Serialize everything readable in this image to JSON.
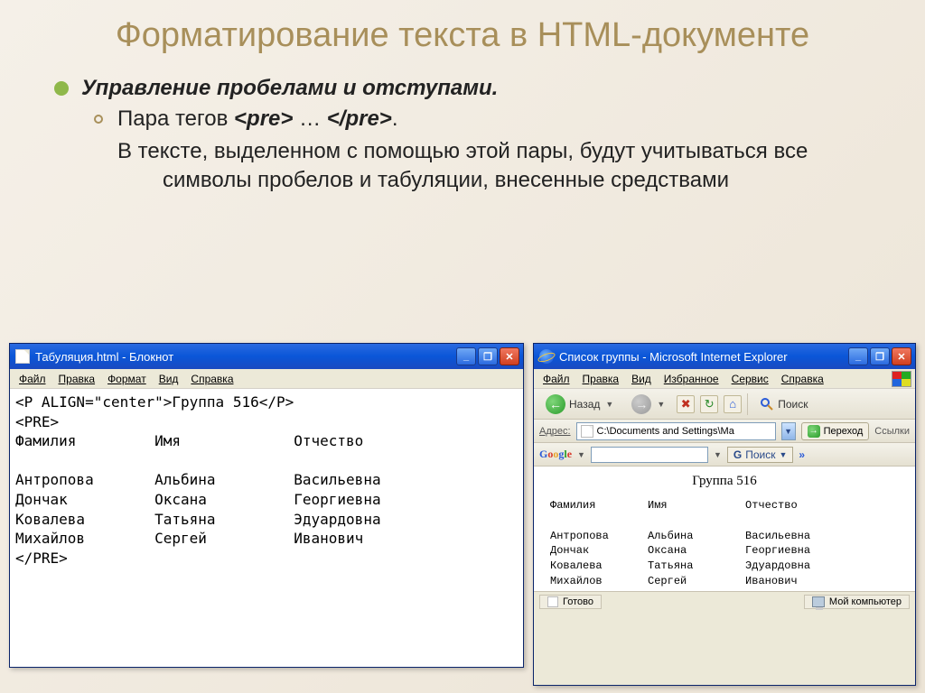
{
  "slide": {
    "title": "Форматирование текста в HTML-документе",
    "bullet1": "Управление пробелами и отступами.",
    "sub_prefix": "Пара тегов ",
    "sub_tag1": "<pre>",
    "sub_mid": " … ",
    "sub_tag2": "</pre>",
    "sub_end": ".",
    "para": "В тексте, выделенном с помощью этой пары, будут    учитываться все символы пробелов и табуляции,    внесенные средствами"
  },
  "notepad": {
    "title": "Табуляция.html - Блокнот",
    "menu": [
      "Файл",
      "Правка",
      "Формат",
      "Вид",
      "Справка"
    ],
    "code": "<P ALIGN=\"center\">Группа 516</P>\n<PRE>\nФамилия         Имя             Отчество\n\nАнтропова       Альбина         Васильевна\nДончак          Оксана          Георгиевна\nКовалева        Татьяна         Эдуардовна\nМихайлов        Сергей          Иванович\n</PRE>",
    "win_btns": {
      "min": "_",
      "max": "❐",
      "close": "✕"
    }
  },
  "ie": {
    "title": "Список группы - Microsoft Internet Explorer",
    "menu": [
      "Файл",
      "Правка",
      "Вид",
      "Избранное",
      "Сервис",
      "Справка"
    ],
    "toolbar": {
      "back": "Назад",
      "search": "Поиск",
      "stop_icon": "✖",
      "refresh_icon": "↻",
      "home_icon": "⌂"
    },
    "address": {
      "label": "Адрес:",
      "value": "C:\\Documents and Settings\\Ма",
      "go": "Переход",
      "links": "Ссылки"
    },
    "google": {
      "label_parts": [
        "G",
        "o",
        "o",
        "g",
        "l",
        "e"
      ],
      "search_prefix": "G",
      "search_label": "Поиск",
      "more": "»"
    },
    "body": {
      "heading": "Группа 516",
      "pre": "Фамилия        Имя            Отчество\n\nАнтропова      Альбина        Васильевна\nДончак         Оксана         Георгиевна\nКовалева       Татьяна        Эдуардовна\nМихайлов       Сергей         Иванович"
    },
    "status": {
      "ready": "Готово",
      "zone": "Мой компьютер"
    }
  }
}
